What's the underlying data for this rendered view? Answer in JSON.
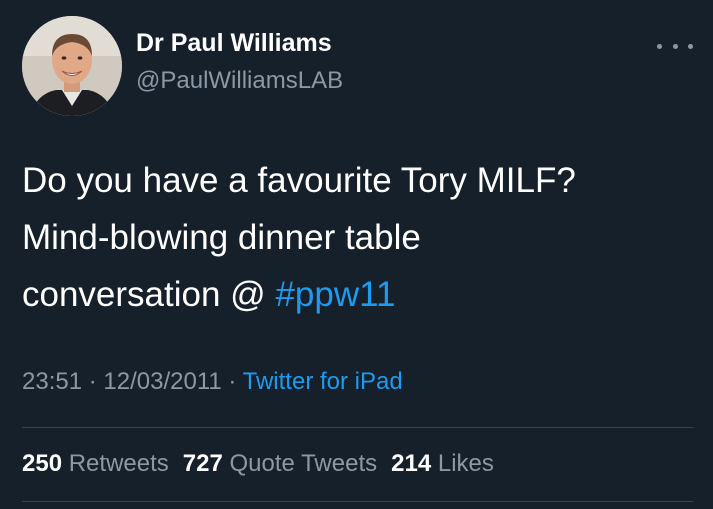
{
  "author": {
    "display_name": "Dr Paul Williams",
    "handle": "@PaulWilliamsLAB"
  },
  "tweet": {
    "line1": "Do you have a favourite Tory MILF?",
    "line2": "Mind-blowing dinner table",
    "line3_text": "conversation @ ",
    "hashtag": "#ppw11"
  },
  "meta": {
    "time": "23:51",
    "separator": " · ",
    "date": "12/03/2011",
    "source": "Twitter for iPad"
  },
  "stats": {
    "retweets_count": "250",
    "retweets_label": "Retweets",
    "quotes_count": "727",
    "quotes_label": "Quote Tweets",
    "likes_count": "214",
    "likes_label": "Likes"
  },
  "icons": {
    "more": "more-options-icon",
    "avatar": "avatar"
  },
  "colors": {
    "background": "#15202b",
    "link": "#1d9bf0",
    "secondary_text": "#8b98a5",
    "divider": "#38444d"
  }
}
